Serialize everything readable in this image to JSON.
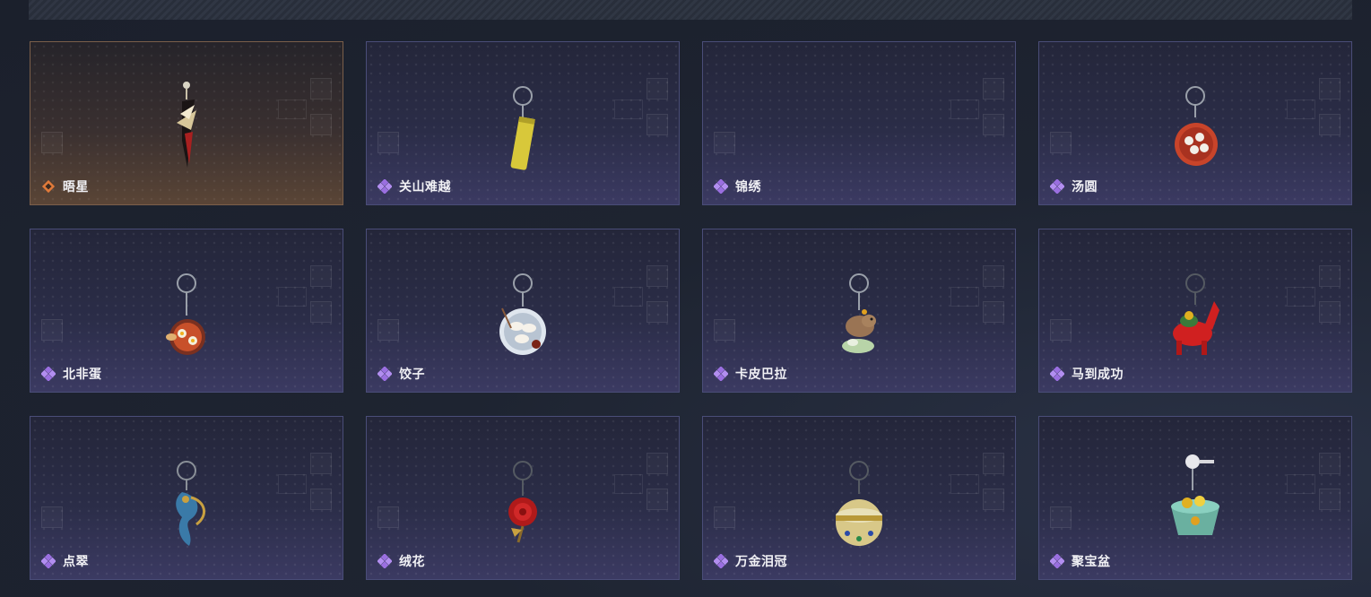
{
  "colors": {
    "rare_gem": "#9a6fe0",
    "legend_gem": "#e07a3a",
    "card_border": "#4a4d78",
    "legend_border": "#7b5f4a"
  },
  "items": [
    {
      "name": "晤星",
      "rarity": "legend",
      "icon": "dagger-charm-icon"
    },
    {
      "name": "关山难越",
      "rarity": "rare",
      "icon": "can-charm-icon"
    },
    {
      "name": "锦绣",
      "rarity": "rare",
      "icon": ""
    },
    {
      "name": "汤圆",
      "rarity": "rare",
      "icon": "tangyuan-bowl-charm-icon"
    },
    {
      "name": "北非蛋",
      "rarity": "rare",
      "icon": "shakshuka-pan-charm-icon"
    },
    {
      "name": "饺子",
      "rarity": "rare",
      "icon": "dumpling-plate-charm-icon"
    },
    {
      "name": "卡皮巴拉",
      "rarity": "rare",
      "icon": "capybara-charm-icon"
    },
    {
      "name": "马到成功",
      "rarity": "rare",
      "icon": "red-horse-charm-icon"
    },
    {
      "name": "点翠",
      "rarity": "rare",
      "icon": "phoenix-charm-icon"
    },
    {
      "name": "绒花",
      "rarity": "rare",
      "icon": "rose-charm-icon"
    },
    {
      "name": "万金泪冠",
      "rarity": "rare",
      "icon": "jeweled-egg-charm-icon"
    },
    {
      "name": "聚宝盆",
      "rarity": "rare",
      "icon": "treasure-bowl-charm-icon"
    }
  ]
}
